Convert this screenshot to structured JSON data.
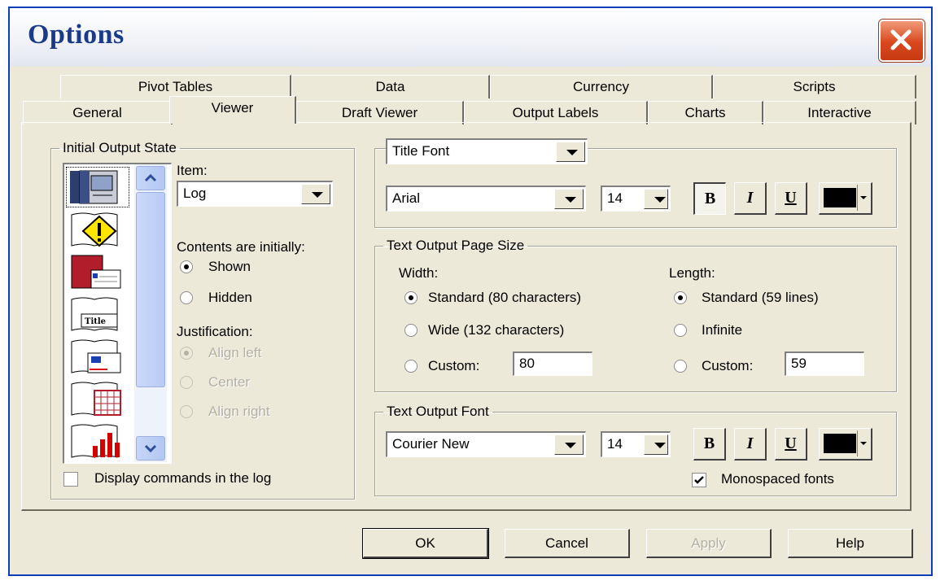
{
  "dialog": {
    "title": "Options"
  },
  "tabs": {
    "row_back": [
      "Pivot Tables",
      "Data",
      "Currency",
      "Scripts"
    ],
    "row_front": [
      "General",
      "Viewer",
      "Draft Viewer",
      "Output Labels",
      "Charts",
      "Interactive"
    ],
    "active": "Viewer"
  },
  "initial_output_state": {
    "legend": "Initial Output State",
    "icon_list": [
      "log-icon",
      "warning-icon",
      "notes-icon",
      "title-icon",
      "text-output-icon",
      "pivot-table-icon",
      "chart-icon"
    ],
    "item_label": "Item:",
    "item_value": "Log",
    "contents_label": "Contents are initially:",
    "shown": "Shown",
    "hidden": "Hidden",
    "contents_selected": "Shown",
    "justification_label": "Justification:",
    "align_left": "Align left",
    "center": "Center",
    "align_right": "Align right",
    "justification_selected": "Align left",
    "display_commands": "Display commands in the log",
    "display_commands_checked": false
  },
  "title_font": {
    "selector": "Title Font",
    "font": "Arial",
    "size": "14",
    "bold_label": "B",
    "italic_label": "I",
    "underline_label": "U",
    "bold_pressed": true,
    "color": "#000000"
  },
  "page_size": {
    "legend": "Text Output Page Size",
    "width_label": "Width:",
    "width_standard": "Standard (80 characters)",
    "width_wide": "Wide (132 characters)",
    "width_custom": "Custom:",
    "width_custom_value": "80",
    "width_selected": "Standard",
    "length_label": "Length:",
    "length_standard": "Standard (59 lines)",
    "length_infinite": "Infinite",
    "length_custom": "Custom:",
    "length_custom_value": "59",
    "length_selected": "Standard"
  },
  "text_font": {
    "legend": "Text Output Font",
    "font": "Courier New",
    "size": "14",
    "bold_label": "B",
    "italic_label": "I",
    "underline_label": "U",
    "color": "#000000",
    "monospaced": "Monospaced fonts",
    "monospaced_checked": true
  },
  "buttons": {
    "ok": "OK",
    "cancel": "Cancel",
    "apply": "Apply",
    "help": "Help"
  }
}
